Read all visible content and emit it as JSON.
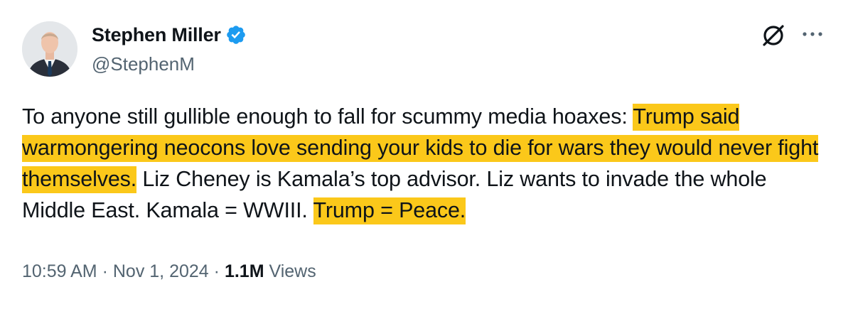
{
  "author": {
    "display_name": "Stephen Miller",
    "handle": "@StephenM",
    "verified": true,
    "avatar_icon": "person-avatar-icon"
  },
  "header_actions": {
    "grok_icon": "grok-slashed-circle-icon",
    "more_icon": "more-horizontal-icon"
  },
  "tweet": {
    "segments": [
      {
        "text": "To anyone still gullible enough to fall for scummy media hoaxes: ",
        "highlight": false
      },
      {
        "text": "Trump said warmongering neocons love sending your kids to die for wars they would never fight themselves.",
        "highlight": true
      },
      {
        "text": " Liz Cheney is Kamala’s top advisor. Liz wants to invade the whole Middle East. Kamala = WWIII. ",
        "highlight": false
      },
      {
        "text": "Trump = Peace.",
        "highlight": true
      }
    ]
  },
  "meta": {
    "time": "10:59 AM",
    "separator": "·",
    "date": "Nov 1, 2024",
    "views_count": "1.1M",
    "views_label": "Views"
  },
  "colors": {
    "text_primary": "#0f1419",
    "text_secondary": "#536471",
    "verified_blue": "#1d9bf0",
    "highlight_yellow": "#fbc81a"
  }
}
